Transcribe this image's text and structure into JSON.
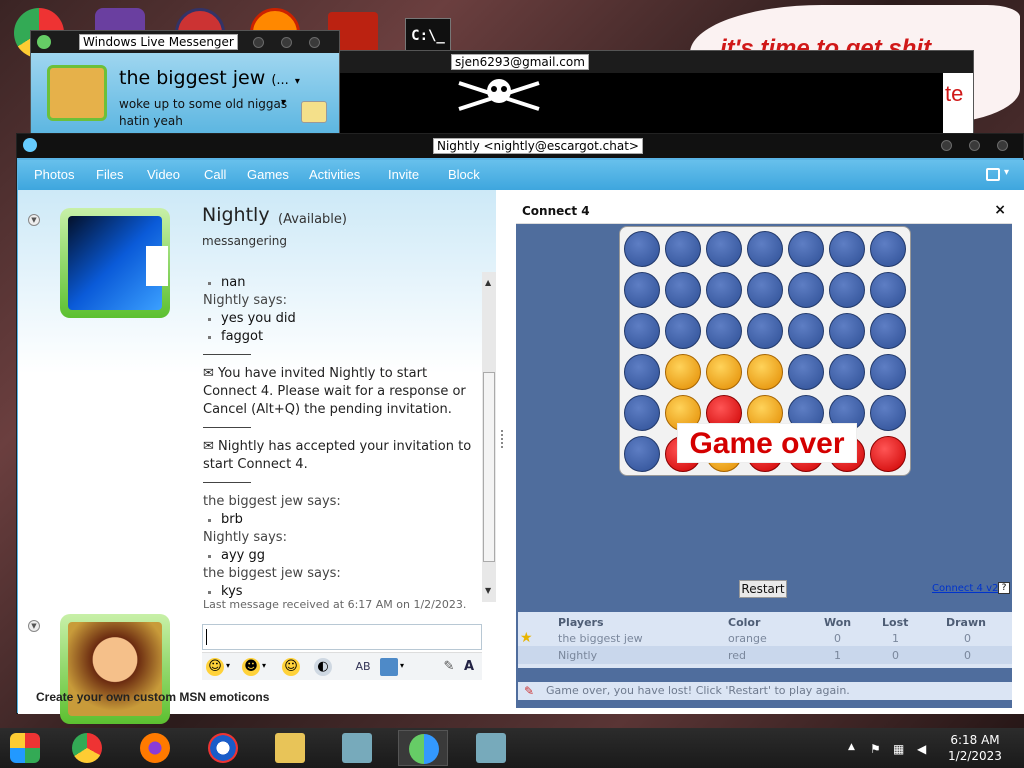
{
  "wlm": {
    "window_title": "Windows Live Messenger",
    "display_name": "the biggest jew",
    "name_suffix": "(...",
    "personal_message": "woke up to some old niggas hatin yeah"
  },
  "pirate_window": {
    "title": "sjen6293@gmail.com"
  },
  "desktop": {
    "banner_text": "it's time to get shit",
    "banner_fragment": "te"
  },
  "chat": {
    "window_title": "Nightly <nightly@escargot.chat>",
    "menu": [
      "Photos",
      "Files",
      "Video",
      "Call",
      "Games",
      "Activities",
      "Invite",
      "Block"
    ],
    "contact": {
      "name": "Nightly",
      "status": "(Available)",
      "message": "messangering"
    },
    "messages": [
      {
        "type": "line",
        "text": "nan"
      },
      {
        "type": "says",
        "text": "Nightly says:"
      },
      {
        "type": "line",
        "text": "yes you did"
      },
      {
        "type": "line",
        "text": "faggot"
      },
      {
        "type": "sep"
      },
      {
        "type": "sys",
        "text": "You have invited Nightly to start Connect 4. Please wait for a response or Cancel (Alt+Q) the pending invitation."
      },
      {
        "type": "sep"
      },
      {
        "type": "sys",
        "text": "Nightly has accepted your invitation to start Connect 4."
      },
      {
        "type": "sep"
      },
      {
        "type": "says",
        "text": "the biggest jew says:"
      },
      {
        "type": "line",
        "text": "brb"
      },
      {
        "type": "says",
        "text": "Nightly says:"
      },
      {
        "type": "line",
        "text": "ayy gg"
      },
      {
        "type": "says",
        "text": "the biggest jew says:"
      },
      {
        "type": "line",
        "text": "kys"
      }
    ],
    "last_message": "Last message received at 6:17 AM on 1/2/2023.",
    "footer_link": "Create your own custom MSN emoticons"
  },
  "game": {
    "title": "Connect 4",
    "close": "×",
    "game_over": "Game over",
    "restart": "Restart",
    "version": "Connect 4 v2.0",
    "help": "?",
    "board": [
      [
        "e",
        "e",
        "e",
        "e",
        "e",
        "e",
        "e"
      ],
      [
        "e",
        "e",
        "e",
        "e",
        "e",
        "e",
        "e"
      ],
      [
        "e",
        "e",
        "e",
        "e",
        "e",
        "e",
        "e"
      ],
      [
        "e",
        "o",
        "o",
        "o",
        "e",
        "e",
        "e"
      ],
      [
        "e",
        "o",
        "r",
        "o",
        "e",
        "e",
        "e"
      ],
      [
        "e",
        "r",
        "o",
        "r",
        "r",
        "r",
        "r"
      ]
    ],
    "players_header": [
      "Players",
      "Color",
      "Won",
      "Lost",
      "Drawn"
    ],
    "players": [
      {
        "name": "the biggest jew",
        "color": "orange",
        "won": "0",
        "lost": "1",
        "drawn": "0"
      },
      {
        "name": "Nightly",
        "color": "red",
        "won": "1",
        "lost": "0",
        "drawn": "0"
      }
    ],
    "status": "Game over, you have lost! Click 'Restart' to play again."
  },
  "taskbar": {
    "time": "6:18 AM",
    "date": "1/2/2023"
  },
  "colors": {
    "accent": "#3ea6de",
    "orange": "#e28a00",
    "red": "#cc0000",
    "board_bg": "#4f6d9d"
  }
}
